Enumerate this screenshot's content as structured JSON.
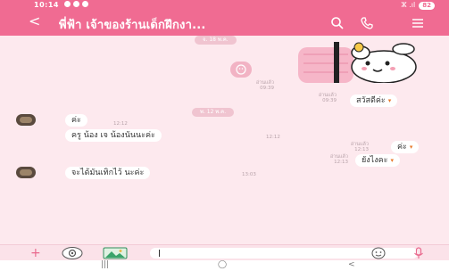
{
  "status_bar": {
    "time": "10:14",
    "signal": "ⵣ .ıl",
    "battery": "82"
  },
  "header": {
    "back": "<",
    "title": "พี่ฟ้า เจ้าของร้านเด็กฝึกงา...",
    "search_icon": "search-icon",
    "call_icon": "phone-icon",
    "menu_icon": "menu-icon"
  },
  "chat": {
    "date_1": "จ. 18 พ.ค.",
    "sent_sticker": {
      "read": "อ่านแล้ว",
      "time": "09:39"
    },
    "msg_hello": {
      "read": "อ่านแล้ว",
      "time": "09:39",
      "text": "สวัสดีค่ะ"
    },
    "date_2": "พ. 12 พ.ค.",
    "recv_1": {
      "text": "ค่ะ",
      "time": "12:12"
    },
    "recv_2": {
      "text": "ครู น้อง เจ น้องนันนะค่ะ",
      "time": "12:12"
    },
    "sent_1": {
      "read": "อ่านแล้ว",
      "time": "12:13",
      "text": "ค่ะ"
    },
    "sent_2": {
      "read": "อ่านแล้ว",
      "time": "12:13",
      "text": "ยังไงคะ"
    },
    "recv_3": {
      "text": "จะได้มันเทิกไว้ นะค่ะ",
      "time": "13:03"
    }
  },
  "input_bar": {
    "plus": "+",
    "placeholder": ""
  },
  "nav_bar": {
    "recents": "|||",
    "home": "◯",
    "back": "<"
  },
  "colors": {
    "accent": "#f06b92",
    "chat_bg": "#fde9ee"
  }
}
